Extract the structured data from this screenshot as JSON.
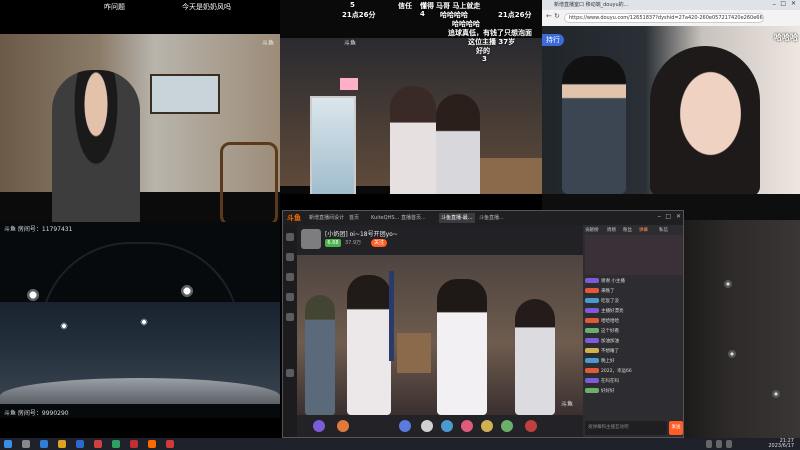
{
  "top_left": {
    "caption_left": "咋问题",
    "caption_right": "今天是奶奶风吗",
    "watermark": "斗鱼"
  },
  "top_mid": {
    "line1_a": "5",
    "line1_b": "信任",
    "line1_c": "懂得",
    "line1_d": "马哥 马上就走",
    "line2_a": "21点26分",
    "line2_b": "4",
    "line2_c": "哈哈哈哈",
    "line2_d": "21点26分",
    "line3": "哈哈哈哈",
    "line4": "追球真低，有钱了只想泡面",
    "line5": "这位主播 37岁",
    "line6": "好的",
    "line7": "3",
    "watermark": "斗鱼"
  },
  "browser": {
    "url": "https://www.douyu.com/12651837?dyshid=27a420-260e057217420e260e660300...",
    "tab_label": "新增直播室口 移动端_douyu的...",
    "pill": "持行",
    "overlay": "哈哈哈"
  },
  "bottom_left": {
    "room_top": "斗鱼 房间号：11797431",
    "room_bottom": "斗鱼 房间号：9990290"
  },
  "client": {
    "logo": "斗鱼",
    "tabs": [
      "斗鱼",
      "新增直播间设计",
      "首页",
      "KuiteQHS...",
      "直播首页...",
      "斗鱼直播-最...",
      "斗鱼直播..."
    ],
    "streamer": "[小奶团] oi~18号开团yo~",
    "level": "6.68",
    "follow": "关注",
    "hot": "37.9万",
    "watermark": "斗鱼",
    "chat_tabs": [
      "贡献榜",
      "周榜",
      "粉丝",
      "弹幕",
      "私信"
    ],
    "messages": [
      "谢谢 小主播",
      "来晚了",
      "吃饭了没",
      "主播好漂亮",
      "哈哈哈哈",
      "这个好看",
      "加油加油",
      "不想睡了",
      "晚上好",
      "2022，幸运66",
      "在吗在吗",
      "好好好"
    ],
    "input_placeholder": "发弹幕和主播互动吧",
    "send": "发送"
  },
  "taskbar": {
    "time": "21:27",
    "date": "2023/6/17"
  }
}
